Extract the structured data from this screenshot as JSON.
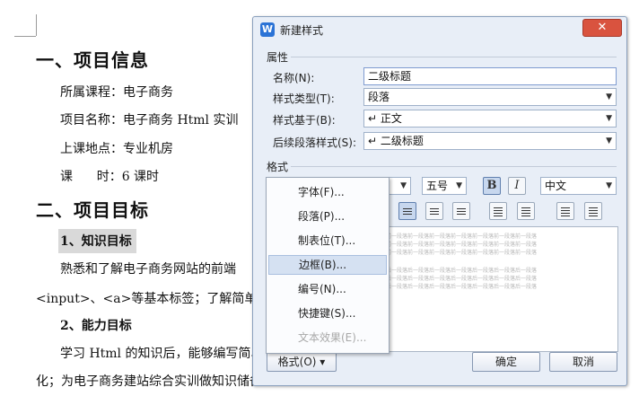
{
  "doc": {
    "h1_1": "一、项目信息",
    "info": [
      "所属课程：电子商务",
      "项目名称：电子商务 Html 实训",
      "上课地点：专业机房",
      "课      时：6 课时"
    ],
    "h1_2": "二、项目目标",
    "h2_1": "1、知识目标",
    "p1": "熟悉和了解电子商务网站的前端",
    "p2": "<input>、<a>等基本标签；了解简单的",
    "h2_2": "2、能力目标",
    "p3": "学习 Html 的知识后，能够编写简单",
    "p4": "化；为电子商务建站综合实训做知识储备"
  },
  "dialog": {
    "title": "新建样式",
    "section_properties": "属性",
    "name_label": "名称(N):",
    "name_value": "二级标题",
    "type_label": "样式类型(T):",
    "type_value": "段落",
    "based_label": "样式基于(B):",
    "based_value": "↵ 正文",
    "next_label": "后续段落样式(S):",
    "next_value": "↵ 二级标题",
    "section_format": "格式",
    "font_size": "五号",
    "bold": "B",
    "italic": "I",
    "lang": "中文",
    "preview_before": "前一段落前一段落前一段落前一段落前一段落前一段落前一段落",
    "preview_after": "后一段落后一段落后一段落后一段落后一段落后一段落后一段落",
    "format_button": "格式(O) ▾",
    "ok": "确定",
    "cancel": "取消"
  },
  "menu": {
    "items": [
      "字体(F)...",
      "段落(P)...",
      "制表位(T)...",
      "边框(B)...",
      "编号(N)...",
      "快捷键(S)...",
      "文本效果(E)..."
    ]
  }
}
